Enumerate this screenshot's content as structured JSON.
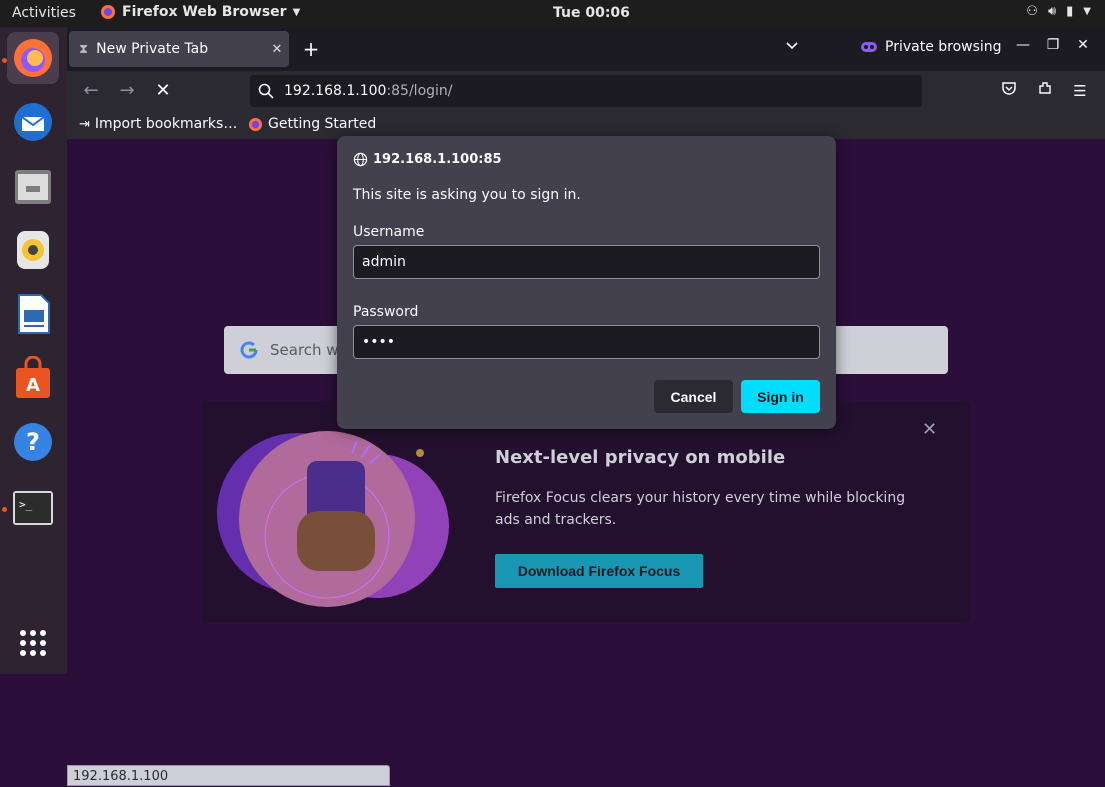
{
  "topbar": {
    "activities": "Activities",
    "app_name": "Firefox Web Browser",
    "clock": "Tue 00:06"
  },
  "dock": {
    "items": [
      "firefox-icon",
      "thunderbird-icon",
      "files-icon",
      "rhythmbox-icon",
      "writer-icon",
      "software-icon",
      "help-icon",
      "terminal-icon",
      "apps-grid-icon"
    ]
  },
  "tabbar": {
    "tab_title": "New Private Tab",
    "private_label": "Private browsing"
  },
  "navbar": {
    "url_host": "192.168.1.100",
    "url_path": ":85/login/"
  },
  "bookmarks": {
    "items": [
      "Import bookmarks…",
      "Getting Started"
    ]
  },
  "content": {
    "search_placeholder": "Search wi",
    "promo_title": "Next-level privacy on mobile",
    "promo_body": "Firefox Focus clears your history every time while blocking ads and trackers.",
    "promo_button": "Download Firefox Focus"
  },
  "statusbar": {
    "text": "192.168.1.100"
  },
  "dialog": {
    "host": "192.168.1.100:85",
    "message": "This site is asking you to sign in.",
    "username_label": "Username",
    "username_value": "admin",
    "password_label": "Password",
    "password_value": "••••",
    "cancel_label": "Cancel",
    "signin_label": "Sign in"
  },
  "colors": {
    "accent": "#00ddff",
    "content_bg": "#2b0e3a",
    "promo_button": "#1996b1"
  }
}
